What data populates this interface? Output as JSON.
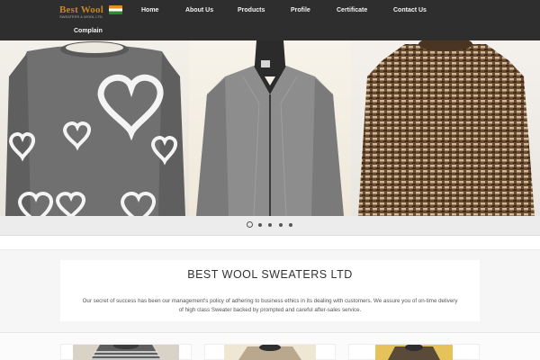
{
  "brand": {
    "name": "Best Wool",
    "tagline": "SWEATERS & WOOL LTD.",
    "colors": {
      "accent": "#c8871e",
      "nav_bg": "#2e2e2e"
    }
  },
  "nav": {
    "items": [
      "Home",
      "About Us",
      "Products",
      "Profile",
      "Certificate",
      "Contact Us",
      "Complain"
    ]
  },
  "slider": {
    "slides": [
      {
        "icon": "grey-heart-sweater-photo"
      },
      {
        "icon": "grey-zip-cardigan-photo"
      },
      {
        "icon": "brown-textured-sweater-photo"
      }
    ],
    "dot_count": 5,
    "active_index": 0
  },
  "intro": {
    "title": "BEST WOOL SWEATERS LTD",
    "line1": "Our secret of success has been our management's policy of adhering to business ethics in its dealing with customers. We assure you of on-time delivery",
    "line2": "of high class Sweater backed by prompted and careful after-sales service."
  },
  "products": [
    {
      "icon": "striped-sweater-thumbnail"
    },
    {
      "icon": "beige-sweater-thumbnail"
    },
    {
      "icon": "yellow-sweater-thumbnail"
    }
  ]
}
